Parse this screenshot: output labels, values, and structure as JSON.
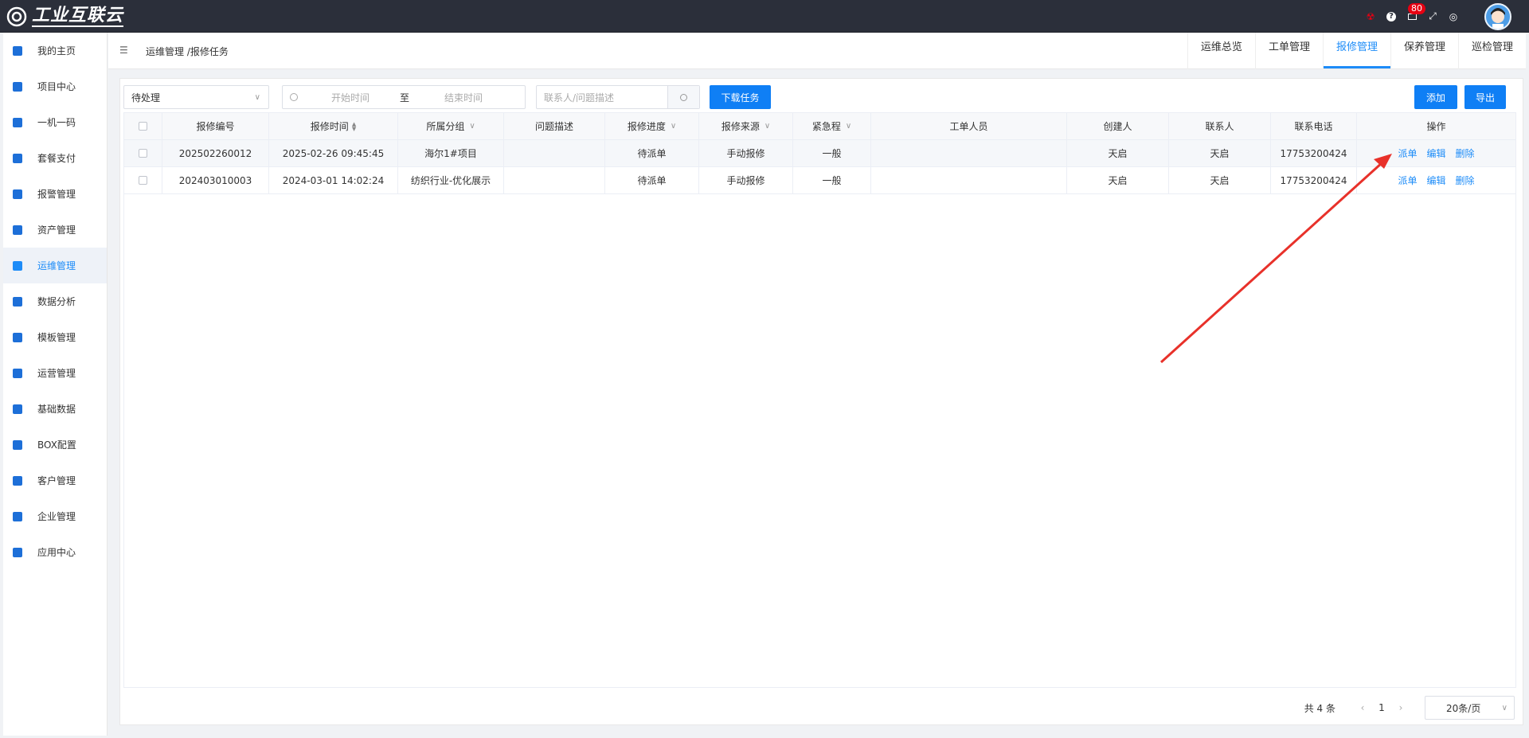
{
  "app": {
    "logo_text": "工业互联云"
  },
  "topbar": {
    "notification_count": "80"
  },
  "sidebar": {
    "items": [
      {
        "label": "我的主页"
      },
      {
        "label": "项目中心"
      },
      {
        "label": "一机一码"
      },
      {
        "label": "套餐支付"
      },
      {
        "label": "报警管理"
      },
      {
        "label": "资产管理"
      },
      {
        "label": "运维管理",
        "active": true
      },
      {
        "label": "数据分析"
      },
      {
        "label": "模板管理"
      },
      {
        "label": "运营管理"
      },
      {
        "label": "基础数据"
      },
      {
        "label": "BOX配置"
      },
      {
        "label": "客户管理"
      },
      {
        "label": "企业管理"
      },
      {
        "label": "应用中心"
      }
    ]
  },
  "header": {
    "breadcrumb": "运维管理 /报修任务",
    "tabs": [
      {
        "label": "运维总览"
      },
      {
        "label": "工单管理"
      },
      {
        "label": "报修管理",
        "active": true
      },
      {
        "label": "保养管理"
      },
      {
        "label": "巡检管理"
      }
    ]
  },
  "filters": {
    "status_value": "待处理",
    "start_placeholder": "开始时间",
    "range_separator": "至",
    "end_placeholder": "结束时间",
    "search_placeholder": "联系人/问题描述",
    "download_label": "下载任务",
    "add_label": "添加",
    "export_label": "导出"
  },
  "table": {
    "headers": {
      "repair_no": "报修编号",
      "repair_time": "报修时间",
      "group": "所属分组",
      "description": "问题描述",
      "progress": "报修进度",
      "source": "报修来源",
      "urgency": "紧急程",
      "worker": "工单人员",
      "creator": "创建人",
      "contact": "联系人",
      "phone": "联系电话",
      "ops": "操作"
    },
    "rows": [
      {
        "repair_no": "202502260012",
        "repair_time": "2025-02-26 09:45:45",
        "group": "海尔1#项目",
        "description": "",
        "progress": "待派单",
        "source": "手动报修",
        "urgency": "一般",
        "worker": "",
        "creator": "天启",
        "contact": "天启",
        "phone": "17753200424"
      },
      {
        "repair_no": "202403010003",
        "repair_time": "2024-03-01 14:02:24",
        "group": "纺织行业-优化展示",
        "description": "",
        "progress": "待派单",
        "source": "手动报修",
        "urgency": "一般",
        "worker": "",
        "creator": "天启",
        "contact": "天启",
        "phone": "17753200424"
      }
    ],
    "ops": {
      "dispatch": "派单",
      "edit": "编辑",
      "delete": "删除"
    }
  },
  "pagination": {
    "total": "共 4 条",
    "current_page": "1",
    "page_size": "20条/页"
  },
  "colors": {
    "accent": "#1d8cf8",
    "topbar": "#2b2f3a",
    "annotation_arrow": "#e8312a"
  },
  "icons": {
    "topbar": [
      "alert-icon",
      "help-icon",
      "mail-icon",
      "fullscreen-icon",
      "language-icon"
    ],
    "sidebar": [
      "home-icon",
      "project-icon",
      "qrcode-icon",
      "package-icon",
      "alarm-icon",
      "asset-icon",
      "maintenance-icon",
      "analysis-icon",
      "template-icon",
      "operation-icon",
      "database-icon",
      "box-icon",
      "customer-icon",
      "enterprise-icon",
      "apps-icon"
    ]
  }
}
